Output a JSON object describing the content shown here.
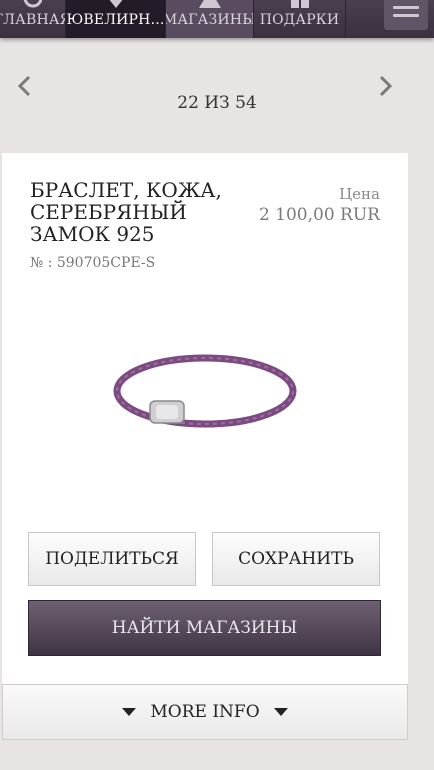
{
  "nav": {
    "tabs": [
      {
        "label": "ГЛАВНАЯ",
        "icon": "home-ring-icon"
      },
      {
        "label": "ЮВЕЛИРН...",
        "icon": "diamond-icon"
      },
      {
        "label": "МАГАЗИНЫ",
        "icon": "store-icon"
      },
      {
        "label": "ПОДАРКИ",
        "icon": "gift-icon"
      }
    ],
    "menu_icon": "hamburger-menu-icon"
  },
  "pager": {
    "text": "22 ИЗ 54",
    "prev_icon": "chevron-left-icon",
    "next_icon": "chevron-right-icon"
  },
  "product": {
    "title": "БРАСЛЕТ, КОЖА, СЕРЕБРЯНЫЙ ЗАМОК 925",
    "sku": "№ : 590705CPE-S",
    "price_label": "Цена",
    "price": "2 100,00 RUR"
  },
  "actions": {
    "share": "ПОДЕЛИТЬСЯ",
    "save": "СОХРАНИТЬ",
    "find_stores": "НАЙТИ МАГАЗИНЫ"
  },
  "more_info": {
    "label": "MORE INFO"
  },
  "colors": {
    "nav_bg": "#3a3040",
    "accent": "#4f4455",
    "bracelet": "#7b4b80"
  }
}
